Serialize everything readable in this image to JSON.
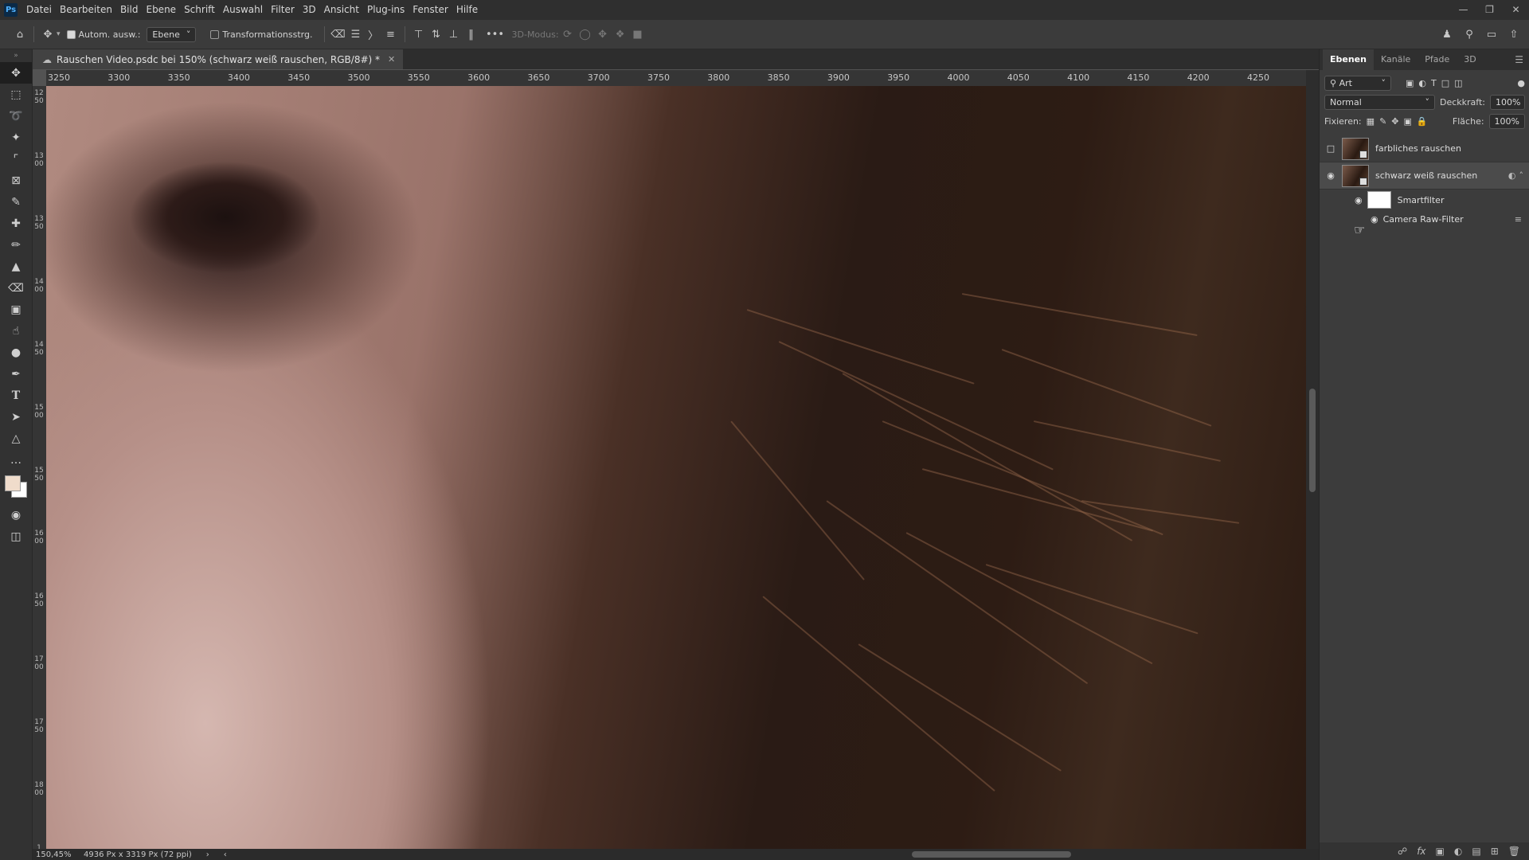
{
  "menubar": {
    "logo": "Ps",
    "items": [
      "Datei",
      "Bearbeiten",
      "Bild",
      "Ebene",
      "Schrift",
      "Auswahl",
      "Filter",
      "3D",
      "Ansicht",
      "Plug-ins",
      "Fenster",
      "Hilfe"
    ],
    "window_controls": [
      "minimize-icon",
      "restore-icon",
      "close-icon"
    ]
  },
  "options": {
    "auto_select_label": "Autom. ausw.:",
    "auto_select_checked": true,
    "target_value": "Ebene",
    "transform_label": "Transformationsstrg.",
    "transform_checked": false,
    "more": "•••",
    "mode_label": "3D-Modus:"
  },
  "document": {
    "tab_title": "Rauschen Video.psdc bei 150% (schwarz weiß rauschen, RGB/8#) *",
    "ruler_h": [
      "3250",
      "3300",
      "3350",
      "3400",
      "3450",
      "3500",
      "3550",
      "3600",
      "3650",
      "3700",
      "3750",
      "3800",
      "3850",
      "3900",
      "3950",
      "4000",
      "4050",
      "4100",
      "4150",
      "4200",
      "4250"
    ],
    "ruler_v": [
      "1250",
      "1300",
      "1350",
      "1400",
      "1450",
      "1500",
      "1550",
      "1600",
      "1650",
      "1700",
      "1750",
      "1800",
      "1"
    ],
    "zoom": "150,45%",
    "dimensions": "4936 Px x 3319 Px (72 ppi)"
  },
  "colors": {
    "foreground": "#f0dccb",
    "background": "#ffffff",
    "accent": "#4fb1ff"
  },
  "layers_panel": {
    "tabs": [
      "Ebenen",
      "Kanäle",
      "Pfade",
      "3D"
    ],
    "active_tab": "Ebenen",
    "filter_kind": "Art",
    "blend_mode": "Normal",
    "opacity_label": "Deckkraft:",
    "opacity_value": "100%",
    "lock_label": "Fixieren:",
    "fill_label": "Fläche:",
    "fill_value": "100%",
    "layers": [
      {
        "name": "farbliches rauschen",
        "visible": false,
        "selected": false
      },
      {
        "name": "schwarz weiß rauschen",
        "visible": true,
        "selected": true
      }
    ],
    "smartfilter_label": "Smartfilter",
    "filter_name": "Camera Raw-Filter"
  }
}
